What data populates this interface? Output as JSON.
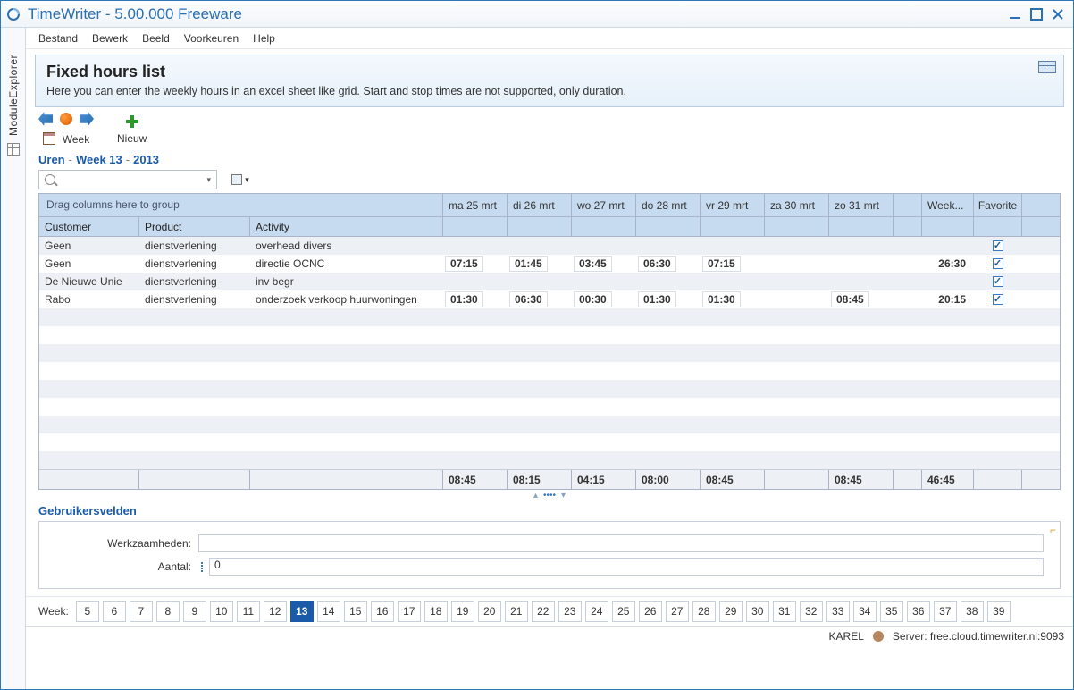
{
  "title": "TimeWriter - 5.00.000 Freeware",
  "sideExplorer": "ModuleExplorer",
  "menu": [
    "Bestand",
    "Bewerk",
    "Beeld",
    "Voorkeuren",
    "Help"
  ],
  "banner": {
    "title": "Fixed hours list",
    "desc": "Here you can enter the weekly hours in an excel sheet like grid. Start and stop times are not supported, only duration."
  },
  "toolbar": {
    "week": "Week",
    "nieuw": "Nieuw"
  },
  "breadcrumb": {
    "a": "Uren",
    "b": "Week 13",
    "c": "2013"
  },
  "grid": {
    "groupHint": "Drag columns here to group",
    "cols": {
      "customer": "Customer",
      "product": "Product",
      "activity": "Activity",
      "week": "Week...",
      "favorite": "Favorite"
    },
    "days": [
      "ma 25 mrt",
      "di 26 mrt",
      "wo 27 mrt",
      "do 28 mrt",
      "vr 29 mrt",
      "za 30 mrt",
      "zo 31 mrt"
    ],
    "rows": [
      {
        "customer": "Geen",
        "product": "dienstverlening",
        "activity": "overhead divers",
        "cells": [
          "",
          "",
          "",
          "",
          "",
          "",
          ""
        ],
        "week": "",
        "fav": true
      },
      {
        "customer": "Geen",
        "product": "dienstverlening",
        "activity": "directie OCNC",
        "cells": [
          "07:15",
          "01:45",
          "03:45",
          "06:30",
          "07:15",
          "",
          ""
        ],
        "week": "26:30",
        "fav": true
      },
      {
        "customer": "De Nieuwe Unie",
        "product": "dienstverlening",
        "activity": "inv begr",
        "cells": [
          "",
          "",
          "",
          "",
          "",
          "",
          ""
        ],
        "week": "",
        "fav": true
      },
      {
        "customer": "Rabo",
        "product": "dienstverlening",
        "activity": "onderzoek verkoop huurwoningen",
        "cells": [
          "01:30",
          "06:30",
          "00:30",
          "01:30",
          "01:30",
          "",
          "08:45"
        ],
        "week": "20:15",
        "fav": true
      }
    ],
    "totals": {
      "cells": [
        "08:45",
        "08:15",
        "04:15",
        "08:00",
        "08:45",
        "",
        "08:45"
      ],
      "week": "46:45"
    }
  },
  "fields": {
    "title": "Gebruikersvelden",
    "werk": "Werkzaamheden:",
    "aantal": "Aantal:",
    "aantalVal": "0"
  },
  "weekbar": {
    "label": "Week:",
    "weeks": [
      "5",
      "6",
      "7",
      "8",
      "9",
      "10",
      "11",
      "12",
      "13",
      "14",
      "15",
      "16",
      "17",
      "18",
      "19",
      "20",
      "21",
      "22",
      "23",
      "24",
      "25",
      "26",
      "27",
      "28",
      "29",
      "30",
      "31",
      "32",
      "33",
      "34",
      "35",
      "36",
      "37",
      "38",
      "39"
    ],
    "active": "13"
  },
  "status": {
    "user": "KAREL",
    "server": "Server: free.cloud.timewriter.nl:9093"
  }
}
